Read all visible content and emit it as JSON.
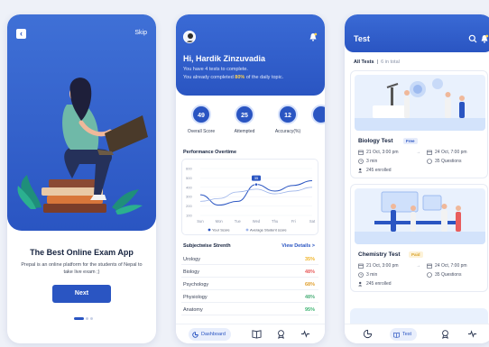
{
  "onboarding": {
    "skip_label": "Skip",
    "title": "The Best Online Exam App",
    "description": "Prepal is an online platform for the students of Nepal to take live exam ;)",
    "next_label": "Next"
  },
  "dashboard": {
    "greeting": "Hi, Hardik Zinzuvadia",
    "tests_line": "You have 4 tests to complete.",
    "progress_prefix": "You already completed ",
    "progress_pct": "80%",
    "progress_suffix": " of the daily topic.",
    "stats": [
      {
        "value": "49",
        "label": "Overall Score"
      },
      {
        "value": "25",
        "label": "Attempted"
      },
      {
        "value": "12",
        "label": "Accuracy(%)"
      }
    ],
    "performance_title": "Performance Overtime",
    "subjectwise_title": "Subjectwise Strenth",
    "view_details": "View Details >",
    "subjects": [
      {
        "name": "Urology",
        "value": "35%"
      },
      {
        "name": "Biology",
        "value": "48%"
      },
      {
        "name": "Psychology",
        "value": "68%"
      },
      {
        "name": "Physiology",
        "value": "48%"
      },
      {
        "name": "Anatomy",
        "value": "95%"
      }
    ],
    "nav_dashboard": "Dashboard"
  },
  "chart_data": {
    "type": "line",
    "x": [
      "Sun",
      "Mon",
      "Tue",
      "Wed",
      "Thu",
      "Fri",
      "Sat"
    ],
    "series": [
      {
        "name": "Your Score",
        "values": [
          320,
          210,
          250,
          430,
          360,
          420,
          470
        ]
      },
      {
        "name": "Average Student score",
        "values": [
          250,
          280,
          350,
          380,
          330,
          360,
          400
        ]
      }
    ],
    "y_ticks": [
      "100",
      "200",
      "300",
      "400",
      "500",
      "600"
    ],
    "ylim": [
      100,
      600
    ],
    "highlight_label": "35",
    "legend": "bottom",
    "colors": {
      "Your Score": "#2a55c2",
      "Average Student score": "#9db4ea"
    }
  },
  "tests": {
    "title": "Test",
    "filter_active": "All Tests",
    "filter_count": "6 in total",
    "cards": [
      {
        "name": "Biology Test",
        "badge": "Free",
        "start": "21 Oct, 3:00 pm",
        "end": "24 Oct, 7:00 pm",
        "duration": "3 min",
        "questions": "35 Questions",
        "enrolled": "245 enrolled"
      },
      {
        "name": "Chemistry Test",
        "badge": "Paid",
        "start": "21 Oct, 3:00 pm",
        "end": "24 Oct, 7:00 pm",
        "duration": "3 min",
        "questions": "35 Questions",
        "enrolled": "245 enrolled"
      }
    ],
    "nav_test": "Test"
  },
  "colors": {
    "primary": "#2a55c2",
    "accent_yellow": "#ffd24d",
    "urology": "#f0b429",
    "biology": "#e85d5d",
    "psychology": "#e0a030",
    "physiology": "#4caf7a",
    "anatomy": "#3cb371"
  }
}
